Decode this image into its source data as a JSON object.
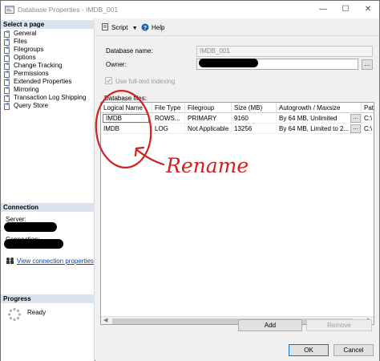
{
  "window": {
    "title": "Database Properties - IMDB_001",
    "minimize": "—",
    "maximize": "☐",
    "close": "✕"
  },
  "sidebar": {
    "select_page_header": "Select a page",
    "pages": [
      {
        "label": "General"
      },
      {
        "label": "Files"
      },
      {
        "label": "Filegroups"
      },
      {
        "label": "Options"
      },
      {
        "label": "Change Tracking"
      },
      {
        "label": "Permissions"
      },
      {
        "label": "Extended Properties"
      },
      {
        "label": "Mirroring"
      },
      {
        "label": "Transaction Log Shipping"
      },
      {
        "label": "Query Store"
      }
    ],
    "connection_header": "Connection",
    "server_label": "Server:",
    "connection_label": "Connection:",
    "view_connection_link": "View connection properties",
    "progress_header": "Progress",
    "progress_status": "Ready"
  },
  "toolbar": {
    "script_label": "Script",
    "help_label": "Help"
  },
  "form": {
    "database_name_label": "Database name:",
    "database_name_value": "IMDB_001",
    "owner_label": "Owner:",
    "owner_browse": "...",
    "fulltext_label": "Use full-text indexing",
    "database_files_label": "Database files:"
  },
  "files_table": {
    "columns": [
      "Logical Name",
      "File Type",
      "Filegroup",
      "Size (MB)",
      "Autogrowth / Maxsize",
      "Path"
    ],
    "rows": [
      {
        "logical_name": "IMDB",
        "file_type": "ROWS...",
        "filegroup": "PRIMARY",
        "size": "9160",
        "autogrowth": "By 64 MB, Unlimited",
        "browse": "...",
        "path": "C:\\"
      },
      {
        "logical_name": "IMDB",
        "file_type": "LOG",
        "filegroup": "Not Applicable",
        "size": "13256",
        "autogrowth": "By 64 MB, Limited to 2...",
        "browse": "...",
        "path": "C:\\"
      }
    ]
  },
  "buttons": {
    "add": "Add",
    "remove": "Remove",
    "ok": "OK",
    "cancel": "Cancel"
  },
  "annotation": {
    "text": "Rename",
    "color": "#d21f1f"
  },
  "colors": {
    "section_header_bg": "#d9e4f0",
    "link": "#0645ad",
    "accent": "#0078d7"
  }
}
